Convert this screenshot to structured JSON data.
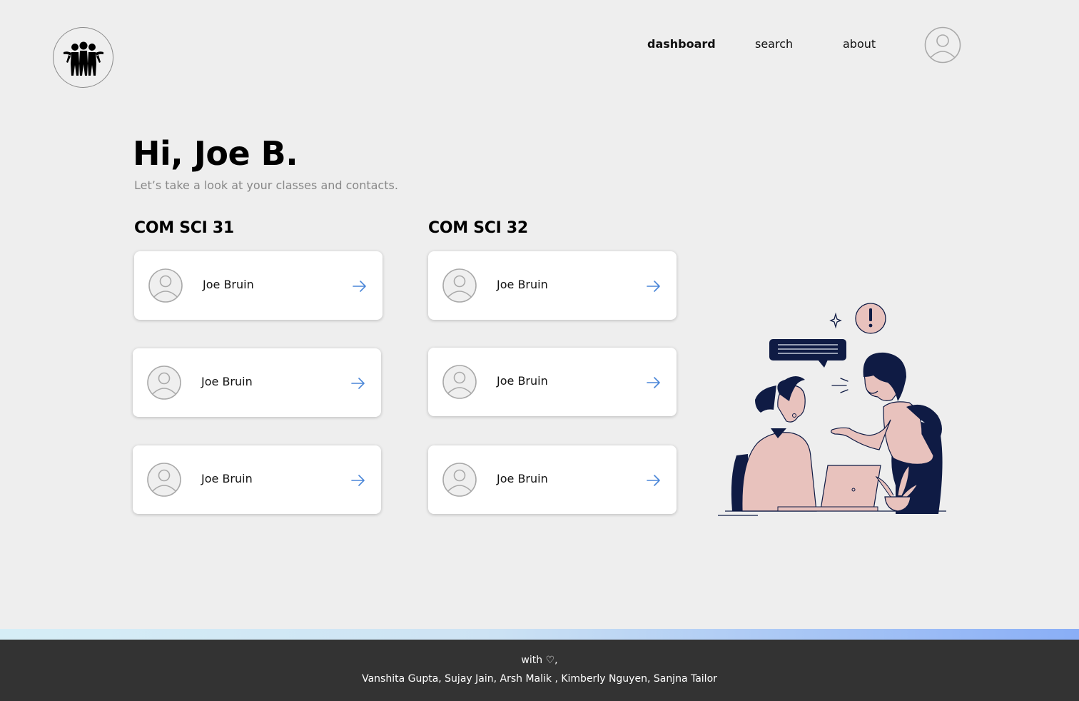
{
  "header": {
    "nav": {
      "dashboard": "dashboard",
      "search": "search",
      "about": "about"
    }
  },
  "main": {
    "greeting": "Hi, Joe B.",
    "subtitle": "Let’s take a look at your classes and contacts."
  },
  "classes": [
    {
      "title": "COM SCI 31",
      "contacts": [
        {
          "name": "Joe Bruin"
        },
        {
          "name": "Joe Bruin"
        },
        {
          "name": "Joe Bruin"
        }
      ]
    },
    {
      "title": "COM SCI 32",
      "contacts": [
        {
          "name": "Joe Bruin"
        },
        {
          "name": "Joe Bruin"
        },
        {
          "name": "Joe Bruin"
        }
      ]
    }
  ],
  "footer": {
    "with": "with ♡,",
    "names": "Vanshita Gupta, Sujay Jain, Arsh Malik , Kimberly Nguyen, Sanjna Tailor"
  },
  "colors": {
    "background": "#eeeeee",
    "accent_arrow": "#4a86d8",
    "footer_bg": "#333333",
    "illustration_navy": "#0f1b44",
    "illustration_pink": "#e8c2bd"
  },
  "icons": {
    "logo": "group-of-people-logo",
    "profile": "user-avatar-icon",
    "contact_avatar": "user-avatar-icon",
    "contact_link": "arrow-right-icon"
  }
}
